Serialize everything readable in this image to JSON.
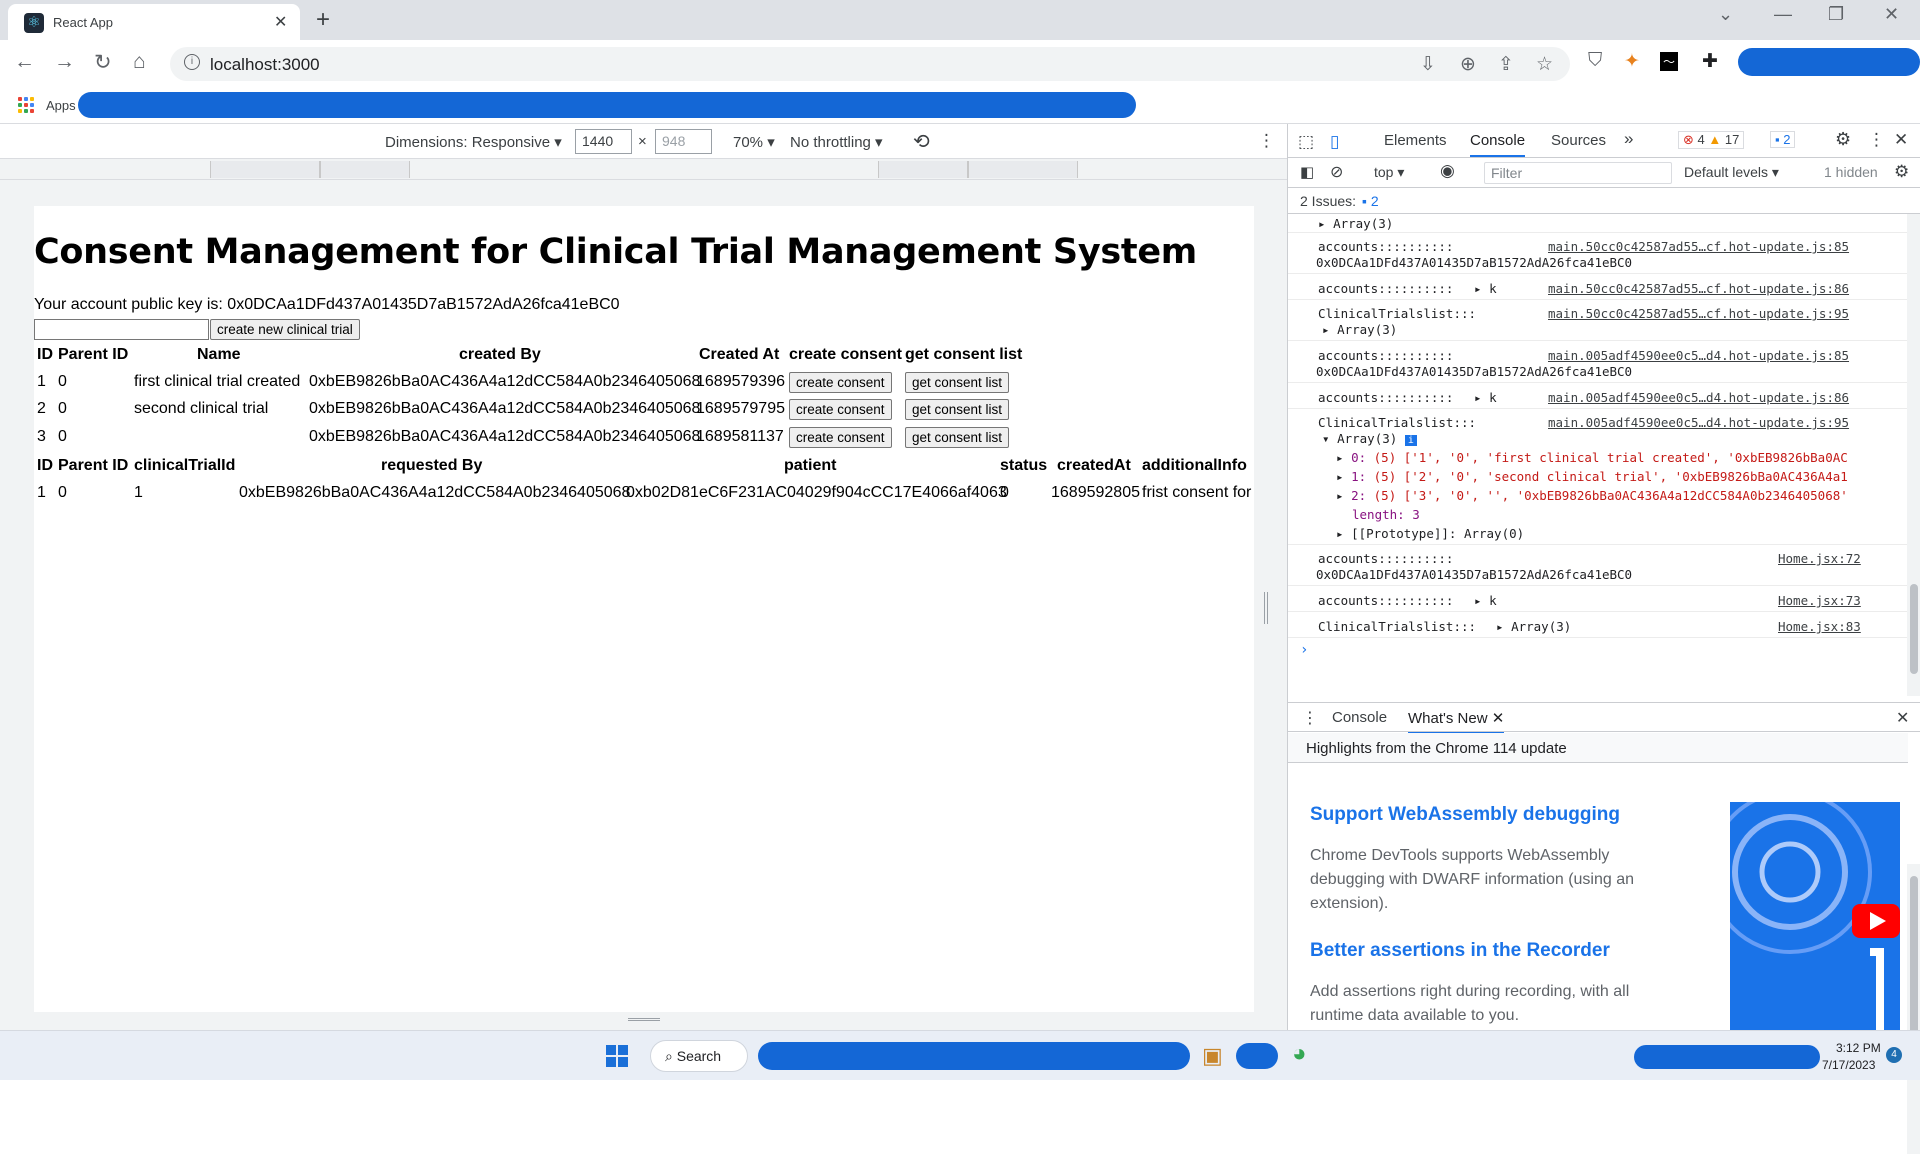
{
  "browser": {
    "tab_title": "React App",
    "url": "localhost:3000",
    "bookmarks_apps_label": "Apps"
  },
  "device_toolbar": {
    "dimensions_label": "Dimensions: Responsive",
    "width_value": "1440",
    "height_value": "948",
    "zoom": "70%",
    "throttling": "No throttling"
  },
  "page": {
    "title": "Consent Management for Clinical Trial Management System",
    "account_line": "Your account public key is: 0x0DCAa1DFd437A01435D7aB1572AdA26fca41eBC0",
    "create_trial_button": "create new clinical trial",
    "trials_headers": [
      "ID",
      "Parent ID",
      "Name",
      "created By",
      "Created At",
      "create consent",
      "get consent list"
    ],
    "trials": [
      {
        "id": "1",
        "parent": "0",
        "name": "first clinical trial created",
        "created_by": "0xbEB9826bBa0AC436A4a12dCC584A0b2346405068",
        "created_at": "1689579396",
        "create_consent": "create consent",
        "get_consent_list": "get consent list"
      },
      {
        "id": "2",
        "parent": "0",
        "name": "second clinical trial",
        "created_by": "0xbEB9826bBa0AC436A4a12dCC584A0b2346405068",
        "created_at": "1689579795",
        "create_consent": "create consent",
        "get_consent_list": "get consent list"
      },
      {
        "id": "3",
        "parent": "0",
        "name": "",
        "created_by": "0xbEB9826bBa0AC436A4a12dCC584A0b2346405068",
        "created_at": "1689581137",
        "create_consent": "create consent",
        "get_consent_list": "get consent list"
      }
    ],
    "consent_headers": [
      "ID",
      "Parent ID",
      "clinicalTrialId",
      "requested By",
      "patient",
      "status",
      "createdAt",
      "additionalInfo"
    ],
    "consents": [
      {
        "id": "1",
        "parent": "0",
        "trial_id": "1",
        "requested_by": "0xbEB9826bBa0AC436A4a12dCC584A0b2346405068",
        "patient": "0xb02D81eC6F231AC04029f904cCC17E4066af4063",
        "status": "0",
        "created_at": "1689592805",
        "additional_info": "frist consent for"
      }
    ]
  },
  "devtools": {
    "tabs": [
      "Elements",
      "Console",
      "Sources"
    ],
    "error_count": "4",
    "warning_count": "17",
    "info_count": "2",
    "context": "top",
    "filter_placeholder": "Filter",
    "levels": "Default levels",
    "hidden": "1 hidden",
    "issues_label": "2 Issues:",
    "issues_count": "2",
    "log": {
      "l0_msg": "Array(3)",
      "l1_msg": "accounts::::::::::",
      "l1_src": "main.50cc0c42587ad55…cf.hot-update.js:85",
      "l1_val": "0x0DCAa1DFd437A01435D7aB1572AdA26fca41eBC0",
      "l2_msg": "accounts::::::::::",
      "l2_val": "k",
      "l2_src": "main.50cc0c42587ad55…cf.hot-update.js:86",
      "l3_msg": "ClinicalTrialslist:::",
      "l3_src": "main.50cc0c42587ad55…cf.hot-update.js:95",
      "l3_val": "Array(3)",
      "l4_msg": "accounts::::::::::",
      "l4_src": "main.005adf4590ee0c5…d4.hot-update.js:85",
      "l4_val": "0x0DCAa1DFd437A01435D7aB1572AdA26fca41eBC0",
      "l5_msg": "accounts::::::::::",
      "l5_val": "k",
      "l5_src": "main.005adf4590ee0c5…d4.hot-update.js:86",
      "l6_msg": "ClinicalTrialslist:::",
      "l6_src": "main.005adf4590ee0c5…d4.hot-update.js:95",
      "l6_val": "Array(3)",
      "l6_e0_key": "0:",
      "l6_e0_val": "(5) ['1', '0', 'first clinical trial created', '0xbEB9826bBa0AC",
      "l6_e1_key": "1:",
      "l6_e1_val": "(5) ['2', '0', 'second clinical trial', '0xbEB9826bBa0AC436A4a1",
      "l6_e2_key": "2:",
      "l6_e2_val": "(5) ['3', '0', '', '0xbEB9826bBa0AC436A4a12dCC584A0b2346405068'",
      "l6_length": "length: 3",
      "l6_proto": "[[Prototype]]: Array(0)",
      "l7_msg": "accounts::::::::::",
      "l7_src": "Home.jsx:72",
      "l7_val": "0x0DCAa1DFd437A01435D7aB1572AdA26fca41eBC0",
      "l8_msg": "accounts::::::::::",
      "l8_val": "k",
      "l8_src": "Home.jsx:73",
      "l9_msg": "ClinicalTrialslist:::",
      "l9_val": "Array(3)",
      "l9_src": "Home.jsx:83"
    },
    "drawer_tabs": [
      "Console",
      "What's New"
    ],
    "highlight": "Highlights from the Chrome 114 update",
    "whats_new": [
      {
        "head": "Support WebAssembly debugging",
        "body": "Chrome DevTools supports WebAssembly debugging with DWARF information (using an extension)."
      },
      {
        "head": "Better assertions in the Recorder",
        "body": "Add assertions right during recording, with all runtime data available to you."
      }
    ]
  },
  "taskbar": {
    "search": "Search",
    "time": "3:12 PM",
    "date": "7/17/2023",
    "notification_count": "4"
  },
  "colors": {
    "accent": "#1a73e8",
    "redaction": "#1467d6",
    "error": "#d93025",
    "warning": "#f29900"
  }
}
